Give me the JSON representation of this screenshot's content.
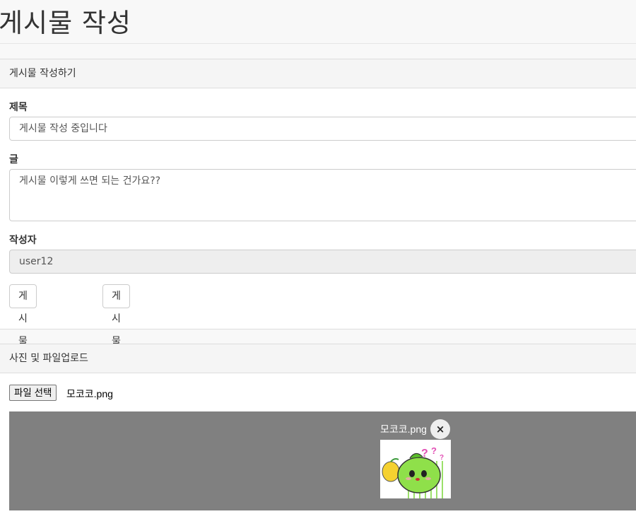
{
  "page": {
    "title": "게시물 작성"
  },
  "write_panel": {
    "heading": "게시물 작성하기",
    "title_label": "제목",
    "title_value": "게시물 작성 중입니다",
    "body_label": "글",
    "body_value": "게시물 이렇게 쓰면 되는 건가요??",
    "author_label": "작성자",
    "author_value": "user12",
    "submit_label": "게시물 작성하기",
    "reset_label": "게시물 다시작성하기"
  },
  "upload_panel": {
    "heading": "사진 및 파일업로드",
    "file_button_label": "파일 선택",
    "selected_file": "모코코.png",
    "preview": {
      "file_name": "모코코.png",
      "remove_label": "×",
      "image_icon": "mokoko-sticker-image"
    }
  },
  "colors": {
    "preview_background": "#808080",
    "readonly_background": "#eeeeee"
  }
}
